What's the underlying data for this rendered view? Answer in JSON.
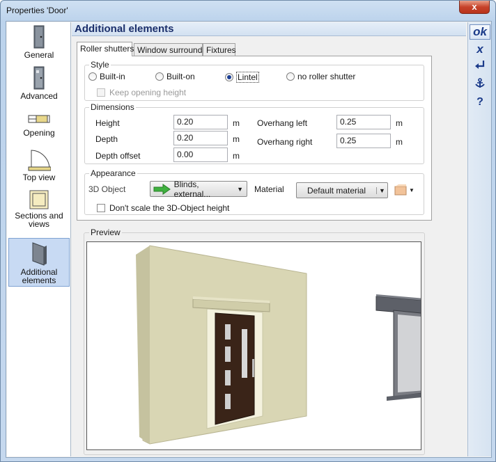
{
  "window": {
    "title": "Properties 'Door'",
    "close_label": "x"
  },
  "sidebar": {
    "items": [
      {
        "label": "General",
        "icon": "door-icon"
      },
      {
        "label": "Advanced",
        "icon": "door-advanced-icon"
      },
      {
        "label": "Opening",
        "icon": "opening-icon"
      },
      {
        "label": "Top view",
        "icon": "top-view-icon"
      },
      {
        "label": "Sections and views",
        "icon": "sections-icon"
      },
      {
        "label": "Additional elements",
        "icon": "additional-elements-icon",
        "selected": true
      }
    ]
  },
  "header": {
    "title": "Additional elements"
  },
  "toolbar": {
    "ok": "ok",
    "cancel": "x",
    "apply_icon": "enter-icon",
    "save_icon": "anchor-icon",
    "help": "?"
  },
  "tabs": [
    "Roller shutters",
    "Window surrounds",
    "Fixtures"
  ],
  "style": {
    "legend": "Style",
    "options": [
      "Built-in",
      "Built-on",
      "Lintel",
      "no roller shutter"
    ],
    "selected": "Lintel",
    "keep_opening_height": "Keep opening height"
  },
  "dimensions": {
    "legend": "Dimensions",
    "height": {
      "label": "Height",
      "value": "0.20",
      "unit": "m"
    },
    "depth": {
      "label": "Depth",
      "value": "0.20",
      "unit": "m"
    },
    "depth_offset": {
      "label": "Depth offset",
      "value": "0.00",
      "unit": "m"
    },
    "overhang_left": {
      "label": "Overhang left",
      "value": "0.25",
      "unit": "m"
    },
    "overhang_right": {
      "label": "Overhang right",
      "value": "0.25",
      "unit": "m"
    }
  },
  "appearance": {
    "legend": "Appearance",
    "object_label": "3D Object",
    "object_value": "Blinds, external...",
    "material_label": "Material",
    "material_value": "Default material",
    "dont_scale": "Don't scale the 3D-Object height"
  },
  "preview": {
    "legend": "Preview"
  },
  "colors": {
    "accent": "#1b2f6b",
    "wall": "#d9d6b4",
    "door": "#3a2418",
    "shutter": "#5d6068"
  }
}
